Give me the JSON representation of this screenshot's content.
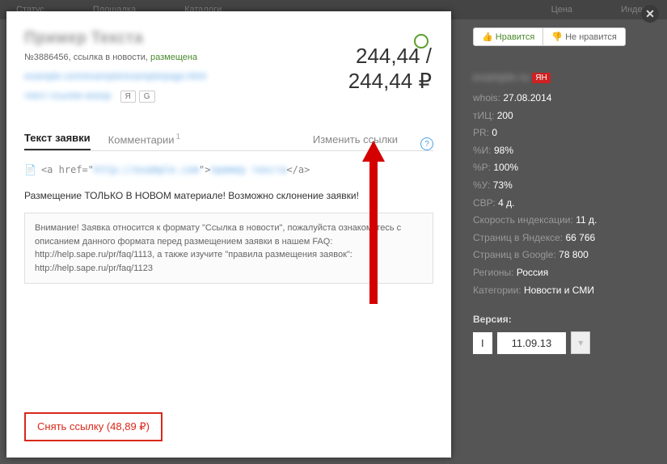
{
  "topbar": {
    "status": "Статус",
    "area": "Площадка",
    "catalogs": "Каталоги",
    "price": "Цена",
    "index": "Индекс"
  },
  "close_icon": "✕",
  "header": {
    "title_blur": "Пример Текста",
    "id_prefix": "№3886456, ",
    "link_type": "ссылка в новости, ",
    "status": "размещена",
    "url_blur": "example.com/example/example/page.html",
    "anchor_blur": "текст ссылки анкор",
    "chip_ya": "Я",
    "chip_g": "G"
  },
  "price": {
    "line": "244,44 /",
    "total": "244,44 ₽"
  },
  "tabs": {
    "text": "Текст заявки",
    "comments": "Комментарии",
    "comments_count": "1",
    "change": "Изменить ссылки",
    "help": "?"
  },
  "code": {
    "open": "<a href=\"",
    "href_blur": "http://example.com",
    "mid": "\">",
    "txt_blur": "пример текста",
    "close": "</a>"
  },
  "body_text": "Размещение ТОЛЬКО В НОВОМ материале! Возможно склонение заявки!",
  "notice": "Внимание! Заявка относится к формату \"Ссылка в новости\", пожалуйста ознакомьтесь с описанием данного формата перед размещением заявки в нашем FAQ: http://help.sape.ru/pr/faq/1113, а также изучите \"правила размещения заявок\": http://help.sape.ru/pr/faq/1123",
  "remove_btn": "Снять ссылку (48,89 ₽)",
  "side": {
    "like": "Нравится",
    "dislike": "Не нравится",
    "site_blur": "example.ru",
    "yan": "ЯН",
    "stats": {
      "whois_l": "whois:",
      "whois_v": "27.08.2014",
      "tic_l": "тИЦ:",
      "tic_v": "200",
      "pr_l": "PR:",
      "pr_v": "0",
      "pi_l": "%И:",
      "pi_v": "98%",
      "pp_l": "%P:",
      "pp_v": "100%",
      "py_l": "%У:",
      "py_v": "73%",
      "svr_l": "СВР:",
      "svr_v": "4 д.",
      "idx_l": "Скорость индексации:",
      "idx_v": "11 д.",
      "yp_l": "Страниц в Яндексе:",
      "yp_v": "66 766",
      "gp_l": "Страниц в Google:",
      "gp_v": "78 800",
      "reg_l": "Регионы:",
      "reg_v": "Россия",
      "cat_l": "Категории:",
      "cat_v": "Новости и СМИ"
    },
    "version_label": "Версия:",
    "version_i": "I",
    "version_date": "11.09.13",
    "dd": "▾"
  }
}
